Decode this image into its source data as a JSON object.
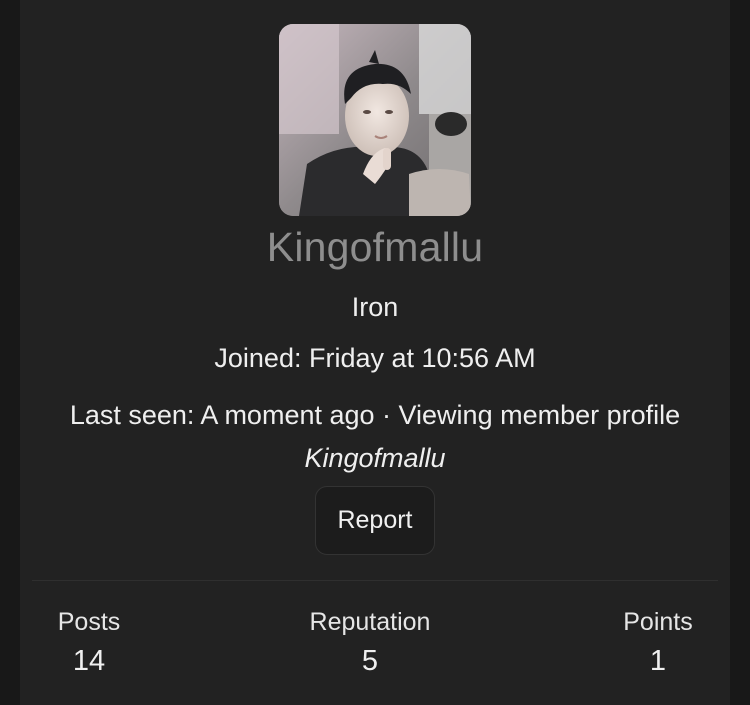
{
  "profile": {
    "username": "Kingofmallu",
    "rank": "Iron",
    "joined": "Joined: Friday at 10:56 AM",
    "last_seen_prefix": "Last seen: A moment ago · Viewing member profile",
    "last_seen_subject": "Kingofmallu",
    "report_label": "Report"
  },
  "stats": {
    "posts_label": "Posts",
    "posts_value": "14",
    "reputation_label": "Reputation",
    "reputation_value": "5",
    "points_label": "Points",
    "points_value": "1"
  }
}
